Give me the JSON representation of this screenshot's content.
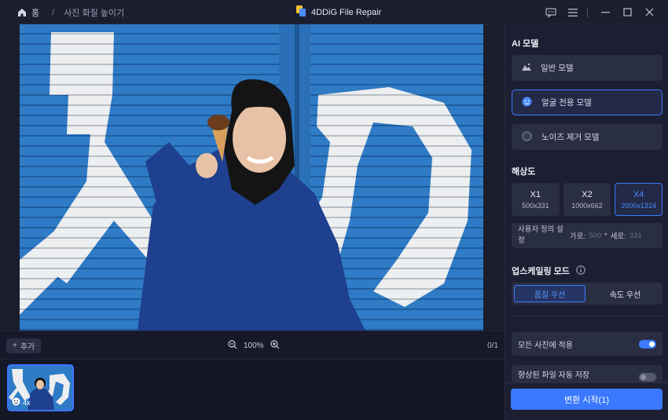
{
  "titlebar": {
    "home_label": "홈",
    "separator": "/",
    "current_page": "사진 화질 높이기",
    "app_title": "4DDiG File Repair"
  },
  "toolbar": {
    "add_label": "추가",
    "zoom_level": "100%",
    "counter": "0/1"
  },
  "thumbnail": {
    "badge": "4x"
  },
  "panel": {
    "ai_model_title": "AI 모델",
    "models": [
      {
        "label": "일반 모델",
        "icon": "mountain-icon",
        "active": false
      },
      {
        "label": "얼굴 전용 모델",
        "icon": "face-icon",
        "active": true
      },
      {
        "label": "노이즈 제거 모델",
        "icon": "circle-icon",
        "active": false
      }
    ],
    "resolution_title": "해상도",
    "resolutions": [
      {
        "scale": "X1",
        "size": "500x331",
        "active": false
      },
      {
        "scale": "X2",
        "size": "1000x662",
        "active": false
      },
      {
        "scale": "X4",
        "size": "2000x1324",
        "active": true
      }
    ],
    "custom": {
      "label": "사용자 정의 설정",
      "width_label": "가로:",
      "width_value": "500",
      "times": "*",
      "height_label": "세로:",
      "height_value": "331"
    },
    "upscale_title": "업스케일링 모드",
    "modes": [
      {
        "label": "품질 우선",
        "active": true
      },
      {
        "label": "속도 우선",
        "active": false
      }
    ],
    "apply_all_label": "모든 사진에 적용",
    "apply_all_on": true,
    "auto_save_label": "향상된 파일 자동 저장",
    "auto_save_on": false,
    "start_button": "변환 시작(1)"
  },
  "colors": {
    "accent": "#3a78ff",
    "background": "#141726",
    "panel": "#1c1f31"
  }
}
